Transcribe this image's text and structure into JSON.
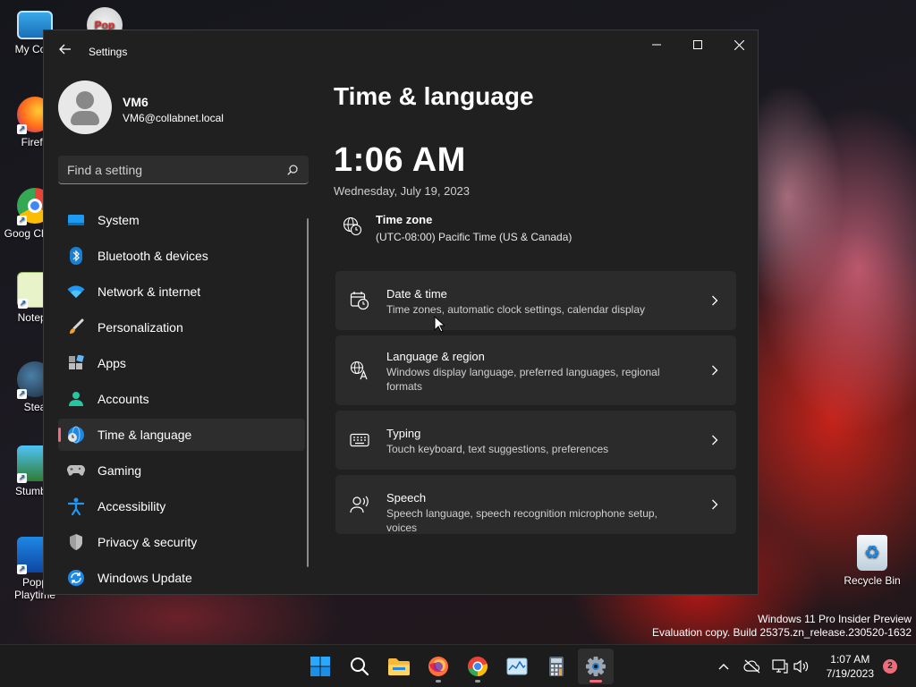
{
  "window": {
    "app_title": "Settings"
  },
  "user": {
    "name": "VM6",
    "email": "VM6@collabnet.local"
  },
  "search": {
    "placeholder": "Find a setting",
    "value": ""
  },
  "nav": {
    "items": [
      {
        "label": "System",
        "icon": "system-icon"
      },
      {
        "label": "Bluetooth & devices",
        "icon": "bluetooth-icon"
      },
      {
        "label": "Network & internet",
        "icon": "wifi-icon"
      },
      {
        "label": "Personalization",
        "icon": "brush-icon"
      },
      {
        "label": "Apps",
        "icon": "apps-icon"
      },
      {
        "label": "Accounts",
        "icon": "person-icon"
      },
      {
        "label": "Time & language",
        "icon": "globe-clock-icon",
        "active": true
      },
      {
        "label": "Gaming",
        "icon": "gamepad-icon"
      },
      {
        "label": "Accessibility",
        "icon": "accessibility-icon"
      },
      {
        "label": "Privacy & security",
        "icon": "shield-icon"
      },
      {
        "label": "Windows Update",
        "icon": "update-icon"
      }
    ]
  },
  "main": {
    "title": "Time & language",
    "clock": "1:06 AM",
    "date": "Wednesday, July 19, 2023",
    "timezone": {
      "title": "Time zone",
      "value": "(UTC-08:00) Pacific Time (US & Canada)"
    },
    "cards": [
      {
        "title": "Date & time",
        "subtitle": "Time zones, automatic clock settings, calendar display",
        "icon": "calendar-clock-icon"
      },
      {
        "title": "Language & region",
        "subtitle": "Windows display language, preferred languages, regional formats",
        "icon": "language-icon"
      },
      {
        "title": "Typing",
        "subtitle": "Touch keyboard, text suggestions, preferences",
        "icon": "keyboard-icon"
      },
      {
        "title": "Speech",
        "subtitle": "Speech language, speech recognition microphone setup, voices",
        "icon": "speech-icon"
      }
    ]
  },
  "desktop": {
    "icons": [
      "My Com",
      "Firefo",
      "Goog Chrom",
      "Notepa",
      "Stea",
      "Stumble",
      "Popp Playtime",
      "Recycle Bin"
    ]
  },
  "watermark": {
    "line1": "Windows 11 Pro Insider Preview",
    "line2": "Evaluation copy. Build 25375.zn_release.230520-1632"
  },
  "taskbar": {
    "time": "1:07 AM",
    "date": "7/19/2023",
    "notification_count": "2"
  },
  "colors": {
    "accent": "#f06c7a",
    "window_bg": "#202020",
    "card_bg": "#2b2b2b"
  }
}
